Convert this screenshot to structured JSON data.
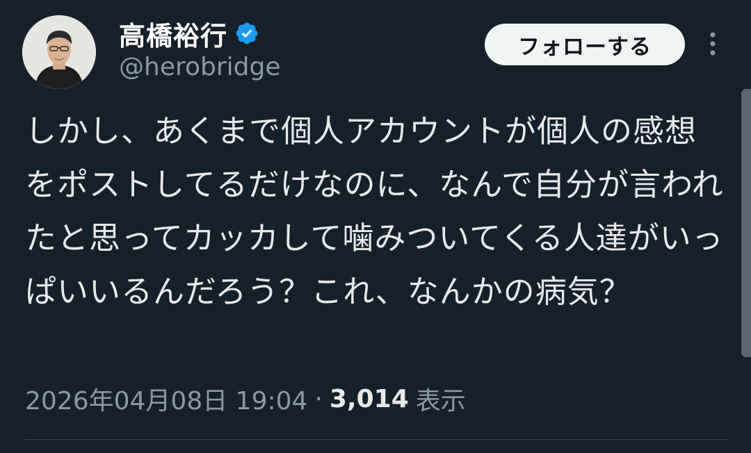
{
  "profile": {
    "display_name": "高橋裕行",
    "handle": "@herobridge",
    "avatar_icon": "profile-photo",
    "verified_icon": "verified-badge-icon",
    "verified_color": "#1d9bf0"
  },
  "actions": {
    "follow_label": "フォローする",
    "more_icon": "more-vertical-icon"
  },
  "tweet": {
    "text": "しかし、あくまで個人アカウントが個人の感想をポストしてるだけなのに、なんで自分が言われたと思ってカッカして噛みついてくる人達がいっぱいいるんだろう？これ、なんかの病気？"
  },
  "meta": {
    "timestamp": "2026年04月08日 19:04",
    "separator": "·",
    "views_count": "3,014",
    "views_label": "表示"
  },
  "colors": {
    "background": "#15202b",
    "primary_text": "#e7e9ea",
    "secondary_text": "#8b98a5",
    "button_bg": "#eff3f4"
  }
}
